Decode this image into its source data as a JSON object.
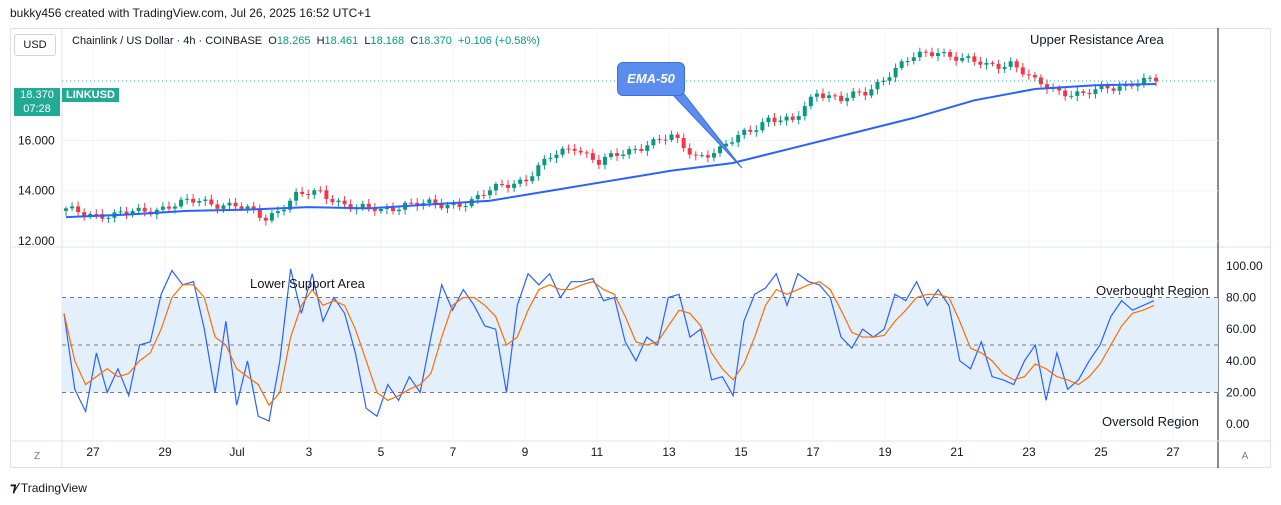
{
  "header": {
    "created_by": "bukky456 created with TradingView.com, Jul 26, 2025 16:52 UTC+1"
  },
  "toolbar": {
    "currency": "USD",
    "zoom_btn": "Z",
    "auto_btn": "A"
  },
  "legend": {
    "symbol_text": "Chainlink / US Dollar · 4h · COINBASE",
    "open_label": "O",
    "open": "18.265",
    "high_label": "H",
    "high": "18.461",
    "low_label": "L",
    "low": "18.168",
    "close_label": "C",
    "close": "18.370",
    "change": "+0.106 (+0.58%)"
  },
  "price_badge": {
    "price": "18.370",
    "countdown": "07:28",
    "symbol": "LINKUSD"
  },
  "annotations": {
    "upper_resistance": "Upper Resistance Area",
    "lower_support": "Lower Support Area",
    "ema_label": "EMA-50",
    "overbought": "Overbought Region",
    "oversold": "Oversold Region"
  },
  "brand": {
    "name": "TradingView"
  },
  "colors": {
    "up": "#089981",
    "down": "#f23645",
    "ema": "#2962ff",
    "k_line": "#2962ff",
    "d_line": "#ff6d00",
    "band_fill": "#e3f0fc",
    "price_line": "#22ab94"
  },
  "chart_data": [
    {
      "type": "candlestick",
      "y_ticks": [
        "12.000",
        "14.000",
        "16.000"
      ],
      "y_tick_values": [
        12,
        14,
        16
      ],
      "ylim": [
        11.8,
        20.4
      ],
      "x_ticks": [
        "27",
        "29",
        "Jul",
        "3",
        "5",
        "7",
        "9",
        "11",
        "13",
        "15",
        "17",
        "19",
        "21",
        "23",
        "25",
        "27"
      ],
      "x_range_days": [
        26.3,
        27.8
      ],
      "last_close": 18.37,
      "ema_period": 50,
      "ema_approx": [
        [
          0,
          12.95
        ],
        [
          10,
          13.05
        ],
        [
          20,
          13.2
        ],
        [
          30,
          13.25
        ],
        [
          40,
          13.35
        ],
        [
          50,
          13.3
        ],
        [
          60,
          13.45
        ],
        [
          70,
          13.6
        ],
        [
          80,
          14.0
        ],
        [
          90,
          14.4
        ],
        [
          100,
          14.8
        ],
        [
          110,
          15.1
        ],
        [
          120,
          15.7
        ],
        [
          130,
          16.3
        ],
        [
          140,
          16.9
        ],
        [
          150,
          17.6
        ],
        [
          160,
          18.05
        ],
        [
          170,
          18.2
        ],
        [
          180,
          18.25
        ]
      ],
      "close_approx": [
        [
          0,
          13.2
        ],
        [
          8,
          13.0
        ],
        [
          15,
          13.3
        ],
        [
          22,
          13.6
        ],
        [
          28,
          13.4
        ],
        [
          33,
          12.9
        ],
        [
          38,
          13.8
        ],
        [
          42,
          13.9
        ],
        [
          48,
          13.3
        ],
        [
          52,
          13.2
        ],
        [
          56,
          13.5
        ],
        [
          62,
          13.4
        ],
        [
          67,
          13.6
        ],
        [
          72,
          14.2
        ],
        [
          76,
          14.5
        ],
        [
          80,
          15.3
        ],
        [
          84,
          15.8
        ],
        [
          88,
          15.1
        ],
        [
          92,
          15.5
        ],
        [
          96,
          15.9
        ],
        [
          100,
          16.1
        ],
        [
          104,
          15.4
        ],
        [
          108,
          15.6
        ],
        [
          112,
          16.3
        ],
        [
          116,
          16.9
        ],
        [
          120,
          16.7
        ],
        [
          124,
          18.0
        ],
        [
          128,
          17.6
        ],
        [
          132,
          17.9
        ],
        [
          136,
          18.7
        ],
        [
          140,
          19.3
        ],
        [
          144,
          19.6
        ],
        [
          148,
          19.2
        ],
        [
          152,
          19.0
        ],
        [
          156,
          19.1
        ],
        [
          160,
          18.3
        ],
        [
          164,
          18.0
        ],
        [
          168,
          17.8
        ],
        [
          172,
          18.1
        ],
        [
          176,
          18.3
        ],
        [
          180,
          18.37
        ]
      ]
    },
    {
      "type": "line",
      "indicator": "Stochastic",
      "y_ticks": [
        "0.00",
        "20.00",
        "40.00",
        "60.00",
        "80.00",
        "100.00"
      ],
      "y_tick_values": [
        0,
        20,
        40,
        60,
        80,
        100
      ],
      "ylim": [
        -10,
        110
      ],
      "bands": [
        20,
        50,
        80
      ],
      "series": [
        {
          "values": [
            70,
            22,
            8,
            45,
            20,
            35,
            18,
            50,
            52,
            82,
            97,
            88,
            90,
            60,
            20,
            65,
            12,
            40,
            5,
            2,
            40,
            98,
            70,
            95,
            65,
            80,
            70,
            45,
            10,
            5,
            25,
            15,
            30,
            20,
            55,
            88,
            72,
            85,
            75,
            62,
            60,
            20,
            75,
            95,
            88,
            95,
            80,
            90,
            90,
            92,
            78,
            80,
            52,
            40,
            55,
            50,
            80,
            82,
            55,
            60,
            28,
            30,
            18,
            65,
            82,
            86,
            95,
            75,
            95,
            90,
            88,
            80,
            55,
            48,
            60,
            55,
            60,
            82,
            78,
            90,
            75,
            85,
            75,
            40,
            35,
            52,
            30,
            28,
            25,
            40,
            50,
            15,
            45,
            22,
            28,
            40,
            50,
            68,
            78,
            72,
            75,
            78
          ]
        },
        {
          "values": [
            70,
            40,
            25,
            30,
            35,
            30,
            32,
            40,
            45,
            60,
            80,
            88,
            88,
            80,
            55,
            50,
            35,
            30,
            25,
            12,
            20,
            55,
            75,
            85,
            75,
            78,
            75,
            60,
            40,
            20,
            15,
            18,
            22,
            25,
            32,
            55,
            75,
            80,
            80,
            75,
            68,
            50,
            55,
            72,
            85,
            88,
            85,
            85,
            88,
            90,
            85,
            82,
            68,
            52,
            50,
            52,
            62,
            72,
            70,
            62,
            45,
            35,
            28,
            38,
            55,
            75,
            85,
            82,
            85,
            88,
            90,
            85,
            72,
            58,
            55,
            55,
            56,
            65,
            72,
            80,
            82,
            82,
            80,
            65,
            48,
            45,
            40,
            32,
            28,
            30,
            38,
            35,
            30,
            28,
            25,
            30,
            38,
            50,
            62,
            70,
            72,
            75
          ]
        }
      ]
    }
  ]
}
